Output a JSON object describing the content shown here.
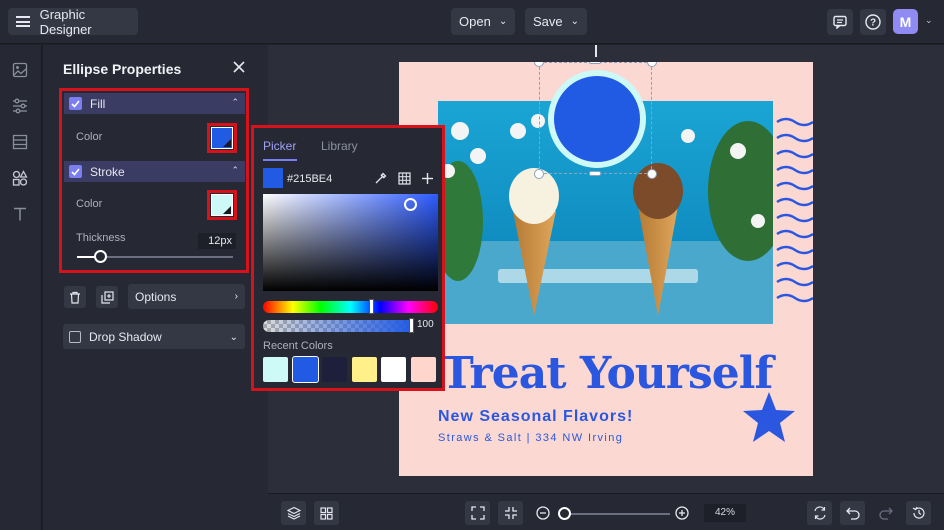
{
  "app": {
    "title": "Graphic Designer"
  },
  "topbar": {
    "open_label": "Open",
    "save_label": "Save",
    "avatar_letter": "M"
  },
  "panel": {
    "title": "Ellipse Properties",
    "fill": {
      "label": "Fill",
      "color_label": "Color",
      "color": "#215BE4"
    },
    "stroke": {
      "label": "Stroke",
      "color_label": "Color",
      "color": "#CDF9F7",
      "thickness_label": "Thickness",
      "thickness_value": "12px",
      "thickness_fraction": 0.15
    },
    "options_label": "Options",
    "drop_shadow_label": "Drop Shadow"
  },
  "picker": {
    "tabs": [
      "Picker",
      "Library"
    ],
    "active_tab": "Picker",
    "hex": "#215BE4",
    "alpha_value": "100",
    "recent_label": "Recent Colors",
    "recent_colors": [
      "#CDF9F7",
      "#215BE4",
      "#1E1F3A",
      "#FFF08A",
      "#FFFFFF",
      "#FFD5CC"
    ]
  },
  "canvas": {
    "headline": "Treat Yourself",
    "subhead": "New Seasonal Flavors!",
    "address": "Straws & Salt  |  334 NW Irving",
    "background": "#FBD9D2",
    "accent": "#2B57E0"
  },
  "bottombar": {
    "zoom_label": "42%",
    "zoom_fraction": 0.05
  },
  "colors": {
    "selection_frame": "#D8121B",
    "ui_accent": "#7A7EF0"
  }
}
